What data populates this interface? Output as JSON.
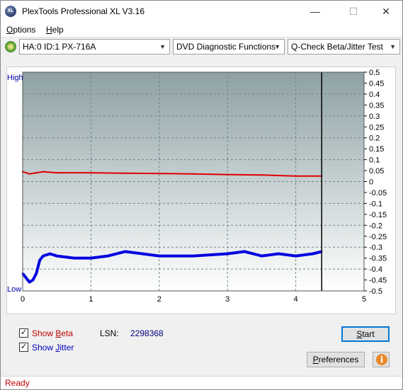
{
  "window": {
    "title": "PlexTools Professional XL V3.16",
    "app_icon_text": "XL",
    "controls": {
      "minimize": "—",
      "maximize": "☐",
      "close": "✕"
    }
  },
  "menu": [
    {
      "label": "Options",
      "accel": "O",
      "rest": "ptions"
    },
    {
      "label": "Help",
      "accel": "H",
      "rest": "elp"
    }
  ],
  "toolbar": {
    "drive": "HA:0 ID:1  PX-716A",
    "function": "DVD Diagnostic Functions",
    "test": "Q-Check Beta/Jitter Test",
    "arrow": "▼"
  },
  "chart": {
    "high_label": "High",
    "low_label": "Low",
    "x_ticks": [
      "0",
      "1",
      "2",
      "3",
      "4",
      "5"
    ],
    "y_ticks": [
      "0.5",
      "0.45",
      "0.4",
      "0.35",
      "0.3",
      "0.25",
      "0.2",
      "0.15",
      "0.1",
      "0.05",
      "0",
      "-0.05",
      "-0.1",
      "-0.15",
      "-0.2",
      "-0.25",
      "-0.3",
      "-0.35",
      "-0.4",
      "-0.45",
      "-0.5"
    ],
    "colors": {
      "beta": "#e00000",
      "jitter": "#0000e0",
      "bg_top": "#8da1a4",
      "bg_bottom": "#ffffff",
      "label": "#0000aa"
    }
  },
  "chart_data": {
    "type": "line",
    "xlabel": "",
    "ylabel": "",
    "xlim": [
      0,
      5
    ],
    "ylim": [
      -0.5,
      0.5
    ],
    "grid": true,
    "end_marker_x": 4.38,
    "series": [
      {
        "name": "Beta",
        "x": [
          0,
          0.1,
          0.2,
          0.3,
          0.5,
          1,
          1.5,
          2,
          2.5,
          3,
          3.5,
          4,
          4.38
        ],
        "values": [
          0.045,
          0.035,
          0.04,
          0.045,
          0.04,
          0.04,
          0.038,
          0.037,
          0.035,
          0.032,
          0.03,
          0.025,
          0.025
        ]
      },
      {
        "name": "Jitter",
        "x": [
          0,
          0.05,
          0.1,
          0.15,
          0.2,
          0.25,
          0.3,
          0.4,
          0.5,
          0.75,
          1,
          1.25,
          1.5,
          2,
          2.5,
          3,
          3.25,
          3.5,
          3.75,
          4,
          4.25,
          4.38
        ],
        "values": [
          -0.42,
          -0.44,
          -0.46,
          -0.45,
          -0.42,
          -0.36,
          -0.34,
          -0.33,
          -0.34,
          -0.35,
          -0.35,
          -0.34,
          -0.32,
          -0.34,
          -0.34,
          -0.33,
          -0.32,
          -0.34,
          -0.33,
          -0.34,
          -0.33,
          -0.32
        ]
      }
    ]
  },
  "bottom": {
    "show_beta": {
      "checked": true,
      "mark": "✓",
      "label_pre": "Show ",
      "accel": "B",
      "label_post": "eta"
    },
    "show_jitter": {
      "checked": true,
      "mark": "✓",
      "label_pre": "Show ",
      "accel": "J",
      "label_post": "itter"
    },
    "lsn_label": "LSN:",
    "lsn_value": "2298368",
    "start": {
      "accel": "S",
      "rest": "tart"
    },
    "preferences": {
      "accel": "P",
      "rest": "references"
    },
    "info_glyph": "i"
  },
  "status": {
    "text": "Ready"
  }
}
